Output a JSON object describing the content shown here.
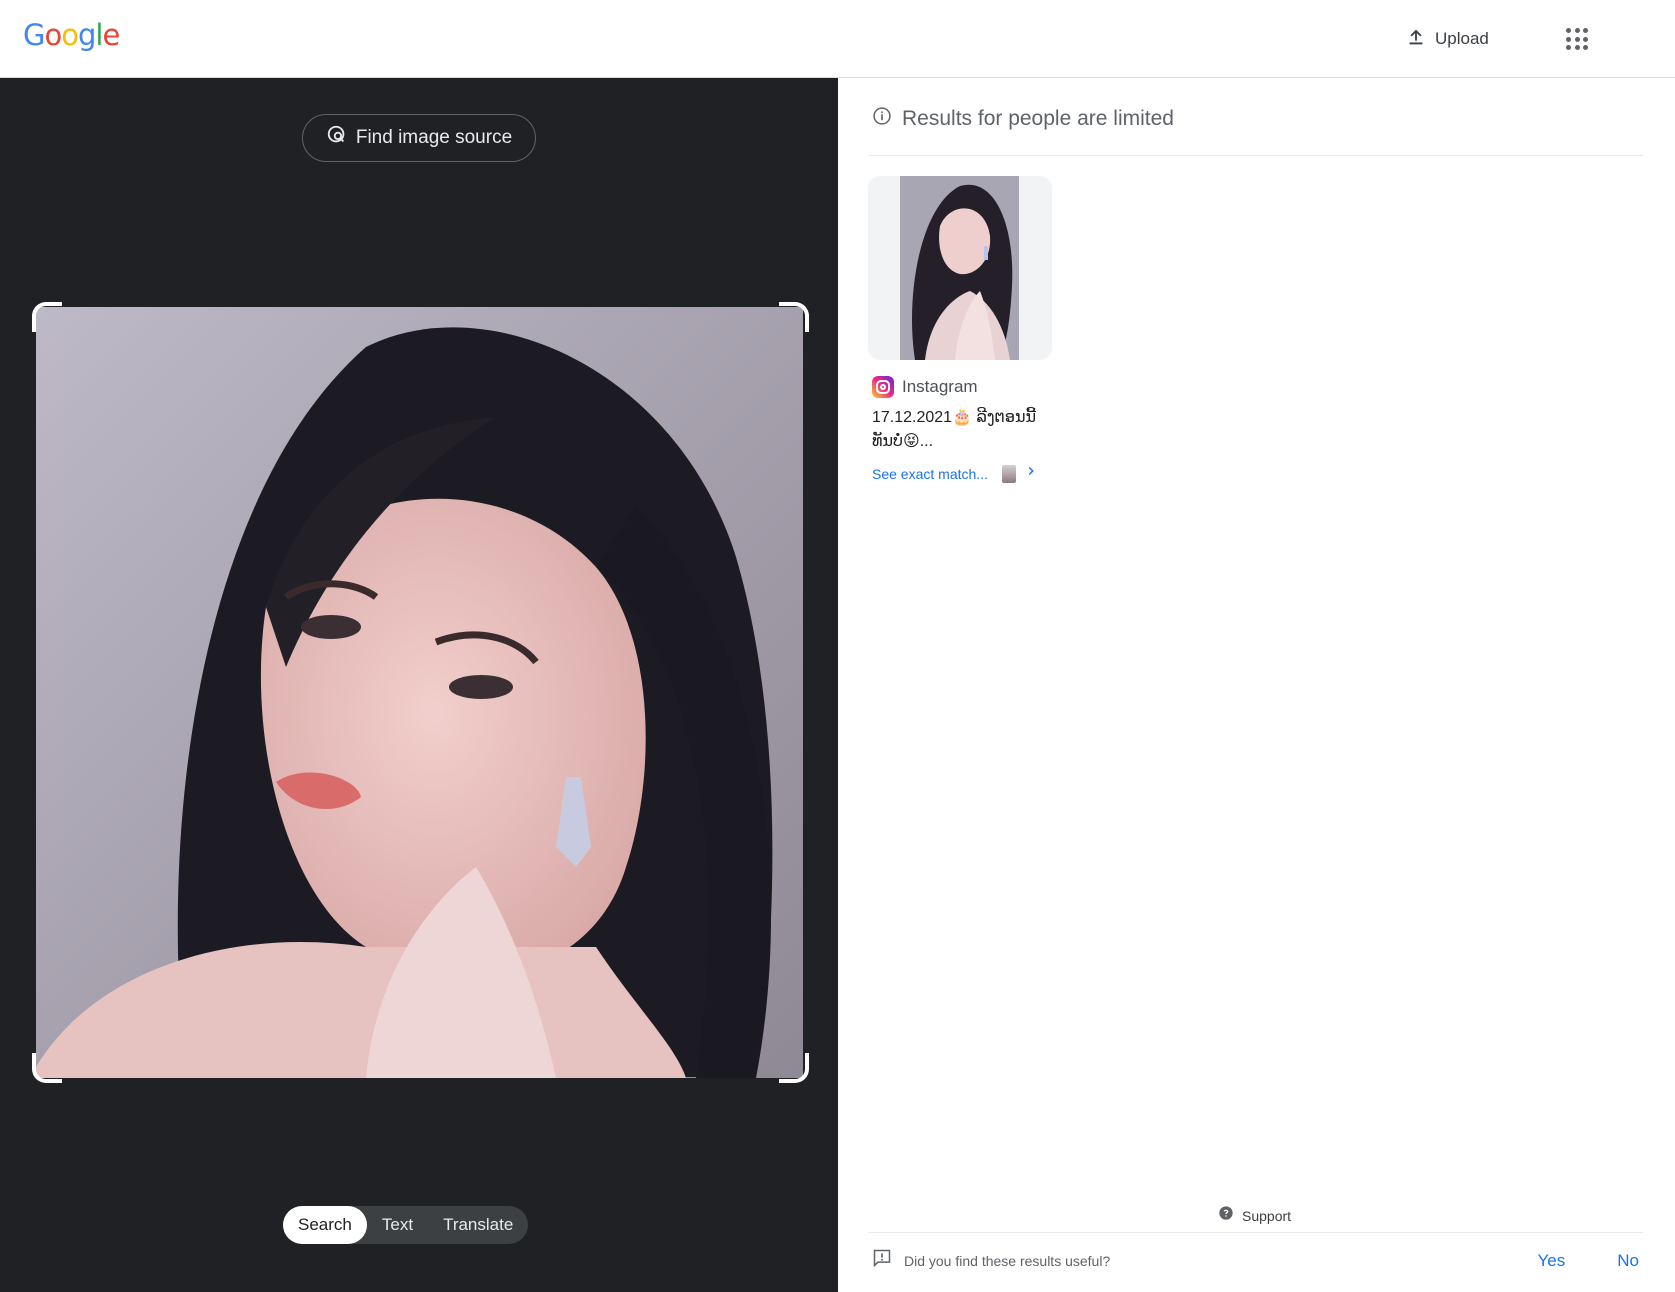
{
  "header": {
    "logo": [
      "G",
      "o",
      "o",
      "g",
      "l",
      "e"
    ],
    "logo_colors": [
      "#4285F4",
      "#EA4335",
      "#FBBC05",
      "#4285F4",
      "#34A853",
      "#EA4335"
    ],
    "upload_label": "Upload"
  },
  "left": {
    "find_source_label": "Find image source",
    "modes": [
      "Search",
      "Text",
      "Translate"
    ],
    "active_mode": "Search"
  },
  "right": {
    "limited_label": "Results for people are limited",
    "result": {
      "source": "Instagram",
      "title": "17.12.2021🎂 ລີງຕອນນີ້ ທັນບໍ່😝...",
      "see_match_label": "See exact match..."
    },
    "support_label": "Support",
    "feedback_question": "Did you find these results useful?",
    "yes_label": "Yes",
    "no_label": "No"
  },
  "colors": {
    "accent": "#1a73e8",
    "dark_panel": "#202124"
  }
}
